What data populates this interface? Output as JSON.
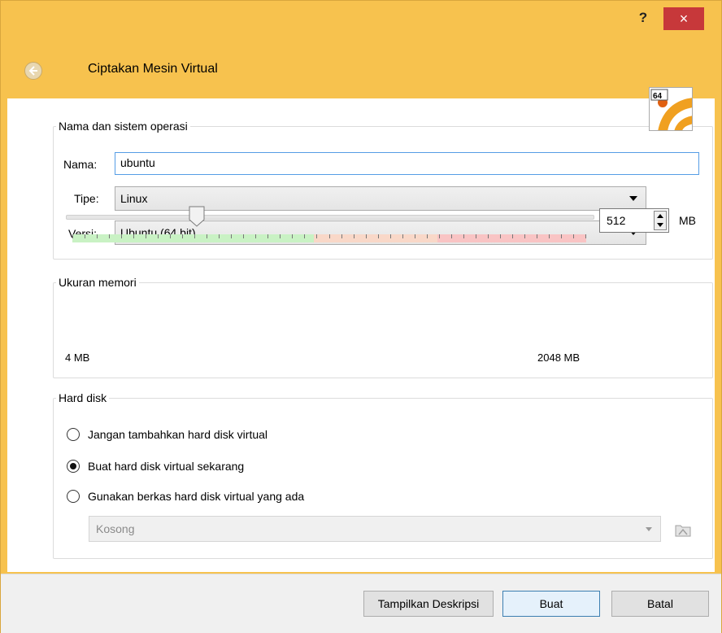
{
  "window": {
    "help_label": "?",
    "close_label": "×",
    "title": "Ciptakan Mesin Virtual"
  },
  "name_os": {
    "legend": "Nama dan sistem operasi",
    "name_label": "Nama:",
    "name_value": "ubuntu",
    "type_label": "Tipe:",
    "type_value": "Linux",
    "version_label": "Versi:",
    "version_value": "Ubuntu (64 bit)",
    "os_badge": "64"
  },
  "memory": {
    "legend": "Ukuran memori",
    "value": "512",
    "unit": "MB",
    "min_label": "4 MB",
    "max_label": "2048 MB",
    "slider_fraction": 0.248
  },
  "hard_disk": {
    "legend": "Hard disk",
    "options": [
      {
        "label": "Jangan tambahkan hard disk virtual",
        "checked": false
      },
      {
        "label": "Buat hard disk virtual sekarang",
        "checked": true
      },
      {
        "label": "Gunakan berkas hard disk virtual yang ada",
        "checked": false
      }
    ],
    "existing_file_value": "Kosong"
  },
  "footer": {
    "show_description_label": "Tampilkan Deskripsi",
    "create_label": "Buat",
    "cancel_label": "Batal"
  },
  "colors": {
    "window_frame": "#f7c24e",
    "close_button": "#c7383a",
    "scale_green": "#c9f2c4",
    "scale_orange": "#f9d8c8",
    "scale_red": "#f9c4c4"
  }
}
